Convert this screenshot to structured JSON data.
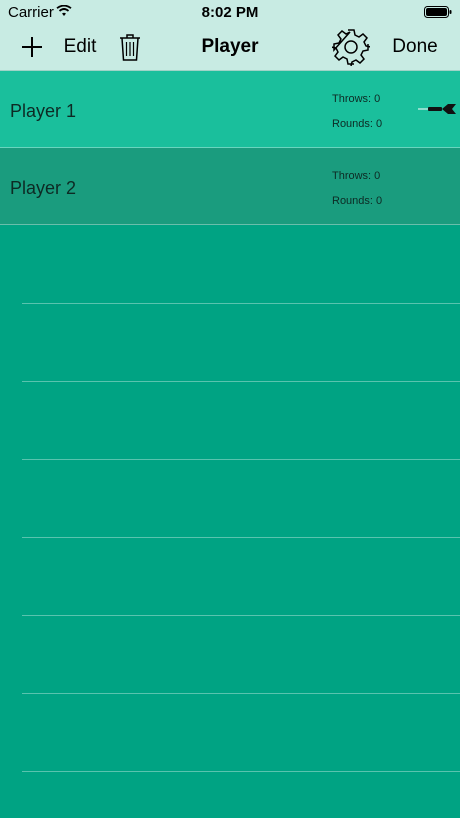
{
  "status": {
    "carrier": "Carrier",
    "time": "8:02 PM"
  },
  "nav": {
    "edit_label": "Edit",
    "title": "Player",
    "done_label": "Done"
  },
  "players": [
    {
      "name": "Player 1",
      "throws": "Throws: 0",
      "rounds": "Rounds: 0",
      "active": true
    },
    {
      "name": "Player 2",
      "throws": "Throws: 0",
      "rounds": "Rounds: 0",
      "active": false
    }
  ],
  "colors": {
    "background": "#00a383",
    "nav_bg": "#c8ebe3",
    "row_active": "#1abf9c",
    "row_inactive": "#1a9c7e"
  }
}
